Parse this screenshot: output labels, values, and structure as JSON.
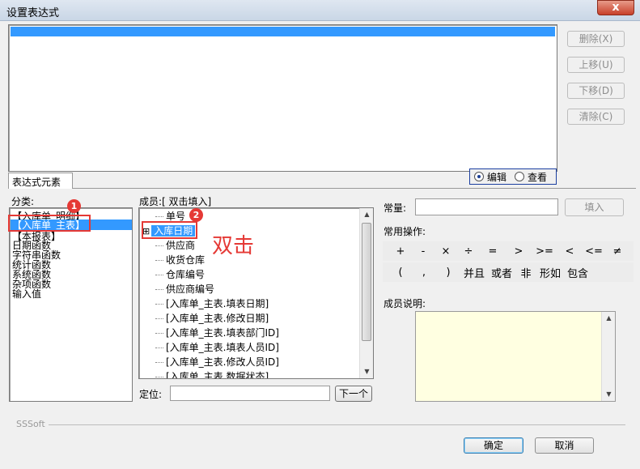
{
  "window": {
    "title": "设置表达式",
    "close_glyph": "x"
  },
  "side_buttons": [
    {
      "label": "删除(X)"
    },
    {
      "label": "上移(U)"
    },
    {
      "label": "下移(D)"
    },
    {
      "label": "清除(C)"
    }
  ],
  "tab": {
    "label": "表达式元素"
  },
  "mode": {
    "edit": "编辑",
    "view": "查看"
  },
  "category": {
    "label": "分类:",
    "items": [
      "【入库单_明细】",
      "【入库单_主表】",
      "【本报表】",
      "日期函数",
      "字符串函数",
      "统计函数",
      "系统函数",
      "杂项函数",
      "输入值"
    ],
    "selected_index": 1
  },
  "members": {
    "label": "成员:[ 双击填入]",
    "items": [
      "单号",
      "入库日期",
      "供应商",
      "收货仓库",
      "仓库编号",
      "供应商编号",
      "[入库单_主表.填表日期]",
      "[入库单_主表.修改日期]",
      "[入库单_主表.填表部门ID]",
      "[入库单_主表.填表人员ID]",
      "[入库单_主表.修改人员ID]",
      "[入库单_主表.数据状态]"
    ],
    "selected_index": 1,
    "expander": "⊞"
  },
  "locate": {
    "label": "定位:",
    "value": "",
    "next_button": "下一个"
  },
  "constant": {
    "label": "常量:",
    "value": "",
    "fill_button": "填入"
  },
  "ops": {
    "label": "常用操作:",
    "row1": [
      "+",
      "-",
      "×",
      "÷",
      "=",
      ">",
      ">=",
      "<",
      "<=",
      "≠"
    ],
    "row2": [
      "(",
      ",",
      ")",
      "并且",
      "或者",
      "非",
      "形如",
      "包含"
    ]
  },
  "member_desc": {
    "label": "成员说明:"
  },
  "footer": {
    "brand": "SSSoft",
    "ok": "确定",
    "cancel": "取消"
  },
  "annotations": {
    "badge1": "1",
    "badge2": "2",
    "double_click": "双击",
    "color": "#e53935"
  }
}
